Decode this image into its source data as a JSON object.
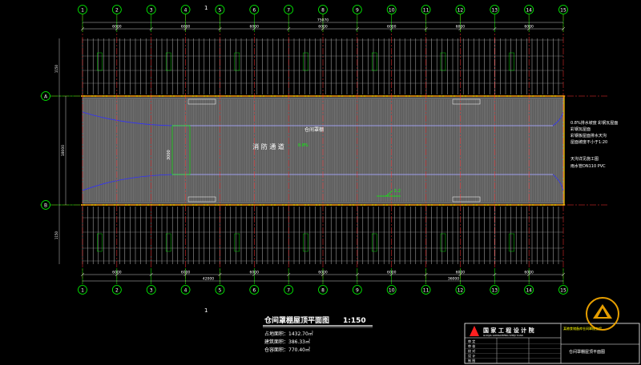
{
  "drawing": {
    "title": "仓间罩棚屋顶平面图",
    "scale": "1:150",
    "stats": [
      "占地面积：1432.70㎡",
      "建筑面积：386.33㎡",
      "仓容面积：770.40㎡"
    ],
    "center_label": "仓间罩棚",
    "passage_label": "消 防 通 道",
    "passage_note": "0.8%",
    "axis_x": [
      "1",
      "2",
      "3",
      "4",
      "5",
      "6",
      "7",
      "8",
      "9",
      "10",
      "11",
      "12",
      "13",
      "14",
      "15"
    ],
    "axis_y": [
      "A",
      "B"
    ],
    "span_dim": "6000",
    "total_dim_top": "75070",
    "total_dim_bottom_left": "42000",
    "total_dim_bottom_right": "36000",
    "depth_dim": "18000",
    "inner_dim": "3000",
    "side_dim": "1150",
    "notes": [
      "0.8%排水坡度 彩钢瓦屋面",
      "彩钢瓦屋面",
      "彩钢板屋面排水天沟",
      "屋面坡度不小于1:20",
      "天沟详见施工图",
      "雨水管DN110 PVC"
    ],
    "callout_note": "1:2"
  },
  "title_block": {
    "company": "国 家 工 程 设 计 院",
    "company_en": "GUOJIA GONGCHENG SHEJI YUAN",
    "project": "某粮食储备库仓间罩棚工程",
    "sheet_name": "仓间罩棚屋顶平面图",
    "rows": [
      "审 定",
      "审 核",
      "校 对",
      "设 计",
      "制 图"
    ]
  },
  "colors": {
    "background": "#000000",
    "grid": "#00ff00",
    "roof": "#c8c8c8",
    "axis_line": "#ff3030",
    "dim": "#ffffff",
    "gutter": "#ffd700",
    "fill_dark": "#555555",
    "accent_blue": "#3030ff",
    "logo": "#ffb000"
  }
}
